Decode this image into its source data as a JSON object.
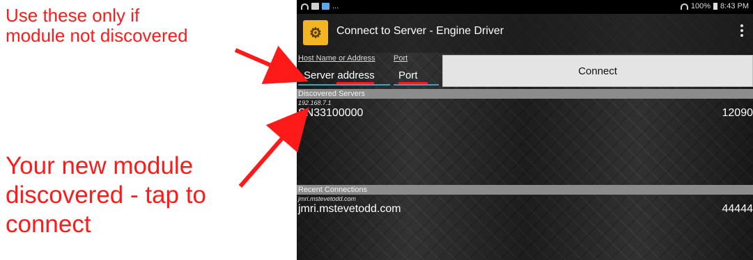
{
  "annotations": {
    "top_line1": "Use these only if",
    "top_line2": "module not discovered",
    "bottom_line1": "Your new module",
    "bottom_line2": "discovered - tap to",
    "bottom_line3": "connect",
    "color": "#ff1a1a"
  },
  "statusbar": {
    "icons_left": [
      "wifi-icon",
      "image-icon",
      "app-icon"
    ],
    "ellipsis": "...",
    "battery": "100%",
    "time": "8:43 PM"
  },
  "appbar": {
    "title": "Connect to Server - Engine Driver",
    "menu": "overflow-menu-icon"
  },
  "form": {
    "host_label": "Host Name or Address",
    "host_value": "Server address",
    "port_label": "Port",
    "port_value": "Port",
    "connect_label": "Connect"
  },
  "discovered": {
    "header": "Discovered Servers",
    "items": [
      {
        "address": "192.168.7.1",
        "name": "SN33100000",
        "port": "12090"
      }
    ]
  },
  "recent": {
    "header": "Recent Connections",
    "items": [
      {
        "address": "jmri.mstevetodd.com",
        "name": "jmri.mstevetodd.com",
        "port": "44444"
      }
    ]
  },
  "colors": {
    "accent": "#2aa5d6",
    "button_bg": "#e4e4e4",
    "section_header": "#8c8c8c",
    "app_icon": "#f3b524"
  }
}
